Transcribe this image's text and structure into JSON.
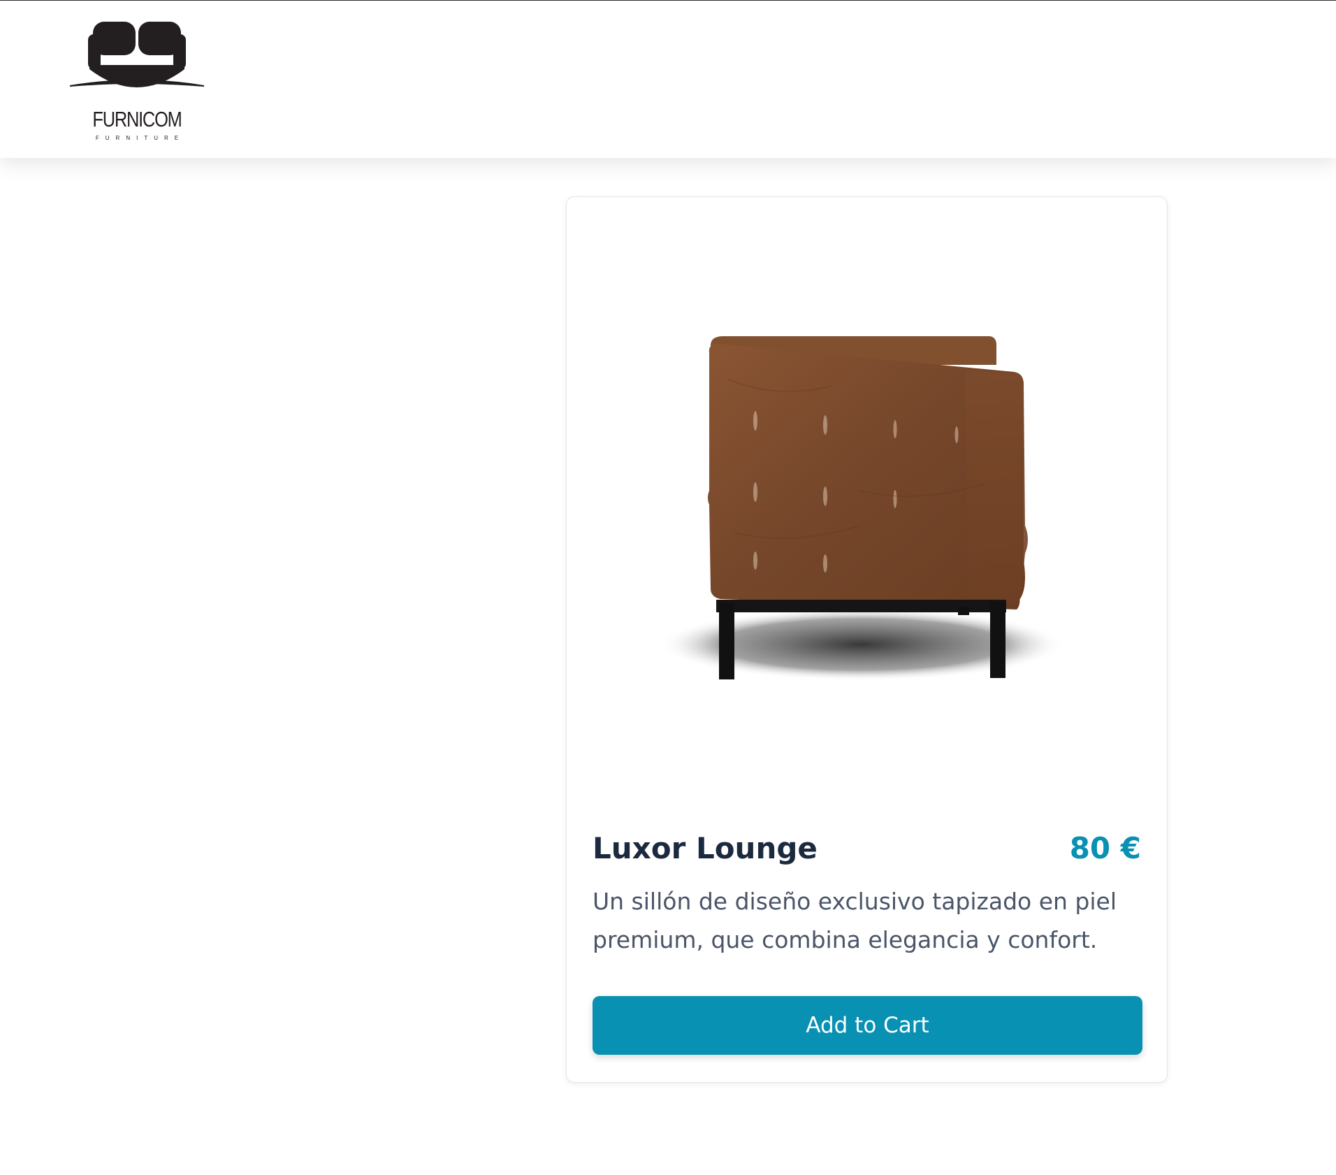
{
  "header": {
    "logo": {
      "name": "FURNICOM",
      "tagline": "FURNITURE",
      "icon": "sofa-logo-icon"
    }
  },
  "product": {
    "image_alt": "brown leather armchair",
    "title": "Luxor Lounge",
    "price": "80 €",
    "description": "Un sillón de diseño exclusivo tapizado en piel premium, que combina elegancia y confort.",
    "add_to_cart_label": "Add to Cart"
  },
  "colors": {
    "accent": "#0891b2",
    "title": "#1b2a3e",
    "text": "#4a5568",
    "leather": "#7a4a2c"
  }
}
